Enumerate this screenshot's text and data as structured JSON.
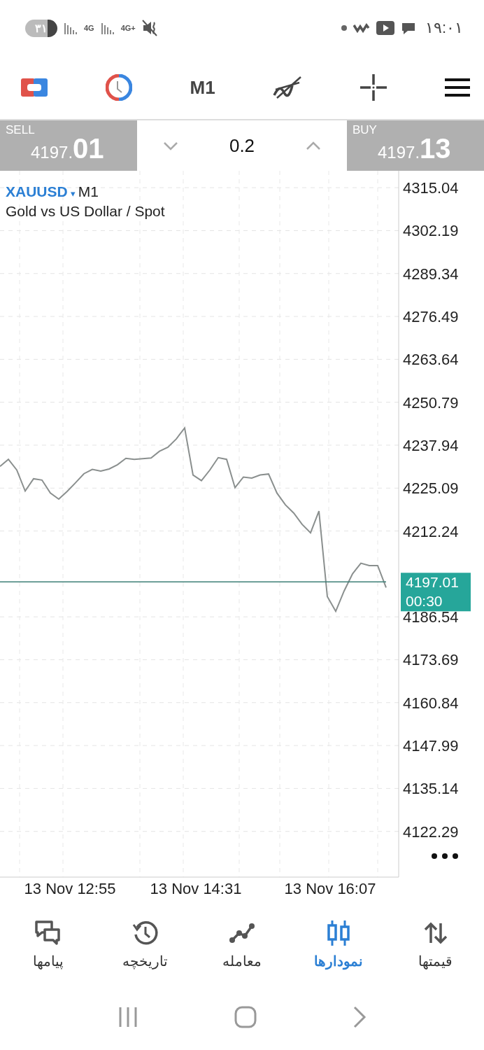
{
  "status_bar": {
    "battery": "۳۱",
    "network_labels": [
      "4G",
      "4G+"
    ],
    "time": "۱۹:۰۱"
  },
  "toolbar": {
    "timeframe": "M1"
  },
  "trade_bar": {
    "sell": {
      "label": "SELL",
      "price_small": "4197.",
      "price_big": "01"
    },
    "volume": "0.2",
    "buy": {
      "label": "BUY",
      "price_small": "4197.",
      "price_big": "13"
    }
  },
  "chart": {
    "symbol": "XAUUSD",
    "marker": "▾",
    "timeframe": "M1",
    "description": "Gold vs US Dollar / Spot",
    "current_price": "4197.01",
    "countdown": "00:30",
    "chart_data": {
      "type": "line",
      "ylim": [
        4108.6,
        4320.1
      ],
      "yticks": [
        4315.04,
        4302.19,
        4289.34,
        4276.49,
        4263.64,
        4250.79,
        4237.94,
        4225.09,
        4212.24,
        4186.54,
        4173.69,
        4160.84,
        4147.99,
        4135.14,
        4122.29
      ],
      "grid": true,
      "categories": [
        null,
        null,
        null,
        null,
        null,
        null,
        null,
        null,
        "13 Nov 12:55",
        null,
        null,
        null,
        null,
        null,
        null,
        null,
        null,
        null,
        null,
        null,
        null,
        null,
        null,
        "13 Nov 14:31",
        null,
        null,
        null,
        null,
        null,
        null,
        null,
        null,
        null,
        null,
        null,
        null,
        null,
        null,
        null,
        "13 Nov 16:07",
        null,
        null,
        null,
        null,
        null,
        null,
        null
      ],
      "series": [
        {
          "color": "#8a8f8e",
          "values": [
            4231.6,
            4233.7,
            4230.5,
            4224.2,
            4227.9,
            4227.5,
            4223.6,
            4221.8,
            4224.1,
            4226.7,
            4229.4,
            4230.7,
            4230.2,
            4230.8,
            4232.1,
            4234.0,
            4233.7,
            4233.9,
            4234.1,
            4236.1,
            4237.3,
            4239.8,
            4243.1,
            4229.0,
            4227.3,
            4230.5,
            4234.2,
            4233.7,
            4225.2,
            4228.4,
            4228.1,
            4229.0,
            4229.3,
            4223.6,
            4220.1,
            4217.6,
            4214.2,
            4211.7,
            4218.2,
            4192.6,
            4188.2,
            4194.3,
            4199.4,
            4202.6,
            4201.9,
            4201.9,
            4195.3
          ]
        },
        {
          "color": "#3d7f77",
          "values": [
            4197.0,
            4197.0,
            4197.0,
            4197.0,
            4197.0,
            4197.0,
            4197.0,
            4197.0,
            4197.0,
            4197.0,
            4197.0,
            4197.0,
            4197.0,
            4197.0,
            4197.0,
            4197.0,
            4197.0,
            4197.0,
            4197.0,
            4197.0,
            4197.0,
            4197.0,
            4197.0,
            4197.0,
            4197.0,
            4197.0,
            4197.0,
            4197.0,
            4197.0,
            4197.0,
            4197.0,
            4197.0,
            4197.0,
            4197.0,
            4197.0,
            4197.0,
            4197.0,
            4197.0,
            4197.0,
            4197.0,
            4197.0,
            4197.0,
            4197.0,
            4197.0,
            4197.0,
            4197.0,
            4197.0
          ]
        }
      ]
    }
  },
  "bottom_nav": [
    {
      "kind": "quotes",
      "label": "قیمتها",
      "selected": false
    },
    {
      "kind": "charts",
      "label": "نمودارها",
      "selected": true
    },
    {
      "kind": "trade",
      "label": "معامله",
      "selected": false
    },
    {
      "kind": "history",
      "label": "تاریخچه",
      "selected": false
    },
    {
      "kind": "messages",
      "label": "پیامها",
      "selected": false
    }
  ]
}
